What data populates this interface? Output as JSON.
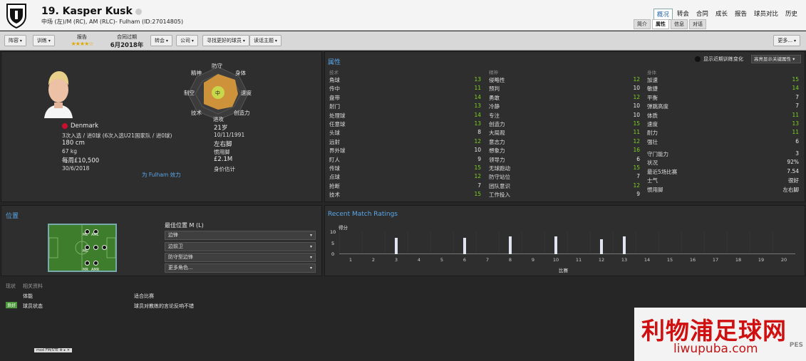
{
  "header": {
    "number_name": "19. Kasper Kusk",
    "subtitle": "中场 (左)/M (RC), AM (RLC)- Fulham (ID:27014805)",
    "nav": [
      "概况",
      "转会",
      "合同",
      "成长",
      "报告",
      "球员对比",
      "历史"
    ],
    "subnav": [
      "简介",
      "属性",
      "信息",
      "对话"
    ]
  },
  "toolbar": {
    "btn1": "阵容",
    "btn2": "训练",
    "report_label": "报告",
    "stars": "★★★★☆",
    "contract_label": "合同过期",
    "contract_value": "6月2018年",
    "btn3": "转会",
    "btn4": "公司",
    "btn5": "寻找更好的球员",
    "btn6": "读话主题",
    "more": "更多..."
  },
  "profile": {
    "nation": "Denmark",
    "caps": "3次入选 / 进0球 (6次入选U21国家队 / 进0球)",
    "height": "180 cm",
    "weight": "67 kg",
    "wage": "每周£10,500",
    "contract_end": "30/6/2018",
    "age": "21岁",
    "dob": "10/11/1991",
    "foot": "左右脚",
    "foot_label": "惯用脚",
    "value": "£2.1M",
    "value_label": "身价估计",
    "link": "为 Fulham 效力"
  },
  "radar": {
    "labels": [
      "防守",
      "身体",
      "速度",
      "创造力",
      "进攻",
      "技术",
      "制空",
      "精神"
    ],
    "center": "中"
  },
  "attrs": {
    "title": "属性",
    "toggle": "显示近期训练变化",
    "highlight": "高亮显示关键属性",
    "cat_tech": "技术",
    "cat_mental": "精神",
    "cat_phys": "身体",
    "tech": [
      [
        "角球",
        "13"
      ],
      [
        "传中",
        "11"
      ],
      [
        "盘带",
        "14"
      ],
      [
        "射门",
        "13"
      ],
      [
        "处理球",
        "14"
      ],
      [
        "任意球",
        "13"
      ],
      [
        "头球",
        "8"
      ],
      [
        "远射",
        "12"
      ],
      [
        "界外球",
        "10"
      ],
      [
        "盯人",
        "9"
      ],
      [
        "传球",
        "15"
      ],
      [
        "点球",
        "12"
      ],
      [
        "抢断",
        "7"
      ],
      [
        "技术",
        "15"
      ]
    ],
    "mental": [
      [
        "侵略性",
        "12"
      ],
      [
        "预判",
        "10"
      ],
      [
        "勇敢",
        "12"
      ],
      [
        "冷静",
        "10"
      ],
      [
        "专注",
        "10"
      ],
      [
        "创造力",
        "15"
      ],
      [
        "大局观",
        "11"
      ],
      [
        "意志力",
        "12"
      ],
      [
        "想象力",
        "16"
      ],
      [
        "领导力",
        "6"
      ],
      [
        "无球跑动",
        "15"
      ],
      [
        "防守站位",
        "7"
      ],
      [
        "团队意识",
        "12"
      ],
      [
        "工作投入",
        "9"
      ]
    ],
    "phys": [
      [
        "加速",
        "15"
      ],
      [
        "敏捷",
        "14"
      ],
      [
        "平衡",
        "7"
      ],
      [
        "弹跳高度",
        "7"
      ],
      [
        "体质",
        "11"
      ],
      [
        "速度",
        "13"
      ],
      [
        "耐力",
        "11"
      ],
      [
        "强壮",
        "6"
      ]
    ],
    "extra": [
      [
        "守门能力",
        "3"
      ],
      [
        "状况",
        "92%"
      ],
      [
        "最近5场比赛",
        "7.54"
      ],
      [
        "士气",
        "很好"
      ],
      [
        "惯用脚",
        "左右脚"
      ]
    ]
  },
  "position": {
    "title": "位置",
    "best_label": "最佳位置 M (L)",
    "roles": [
      "边锋",
      "边前卫",
      "防守型边锋",
      "更多角色..."
    ],
    "pitch_labels": [
      "ML",
      "AML",
      "MC",
      "MR",
      "AMR"
    ]
  },
  "ratings": {
    "title": "Recent Match Ratings",
    "ylabel": "得分",
    "xlabel": "比赛",
    "yticks": [
      "10",
      "5",
      "0"
    ],
    "x": [
      "1",
      "2",
      "3",
      "4",
      "5",
      "6",
      "7",
      "8",
      "9",
      "10",
      "11",
      "12",
      "13",
      "14",
      "15",
      "16",
      "17",
      "18",
      "19",
      "20"
    ],
    "values": [
      0,
      0,
      7,
      0,
      0,
      7,
      0,
      7.5,
      0,
      7.5,
      0,
      6.5,
      7.5,
      0,
      0,
      0,
      0,
      0,
      0,
      0
    ]
  },
  "bottom": {
    "tab1": "现状",
    "tab2": "相关资料",
    "col1": "体能",
    "col2": "适合比赛",
    "badge": "良好",
    "row_label": "球员状态",
    "row_text": "球员对教练的言论反响不错",
    "tag": "mod FM/STE"
  },
  "watermark": {
    "line1": "利物浦足球网",
    "line2": "liwupuba.com",
    "corner": "PES"
  },
  "colors": {
    "accent": "#5aa7e8",
    "green": "#7ed321",
    "radar_fill": "#e8a23a"
  }
}
